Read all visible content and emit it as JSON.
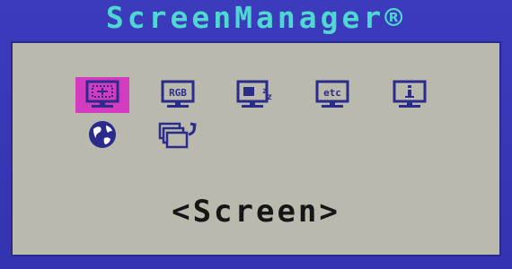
{
  "window": {
    "title": "ScreenManager®"
  },
  "menu": {
    "items": [
      {
        "id": "screen",
        "icon": "screen-icon",
        "selected": true
      },
      {
        "id": "color",
        "icon": "rgb-monitor-icon",
        "selected": false
      },
      {
        "id": "powersave",
        "icon": "sleep-monitor-icon",
        "selected": false
      },
      {
        "id": "others",
        "icon": "etc-monitor-icon",
        "selected": false
      },
      {
        "id": "information",
        "icon": "info-monitor-icon",
        "selected": false
      },
      {
        "id": "language",
        "icon": "globe-icon",
        "selected": false
      },
      {
        "id": "reset",
        "icon": "reset-windows-icon",
        "selected": false
      }
    ],
    "current_label": "<Screen>"
  },
  "colors": {
    "frame": "#3b3bbc",
    "title": "#4fd7d2",
    "panel": "#b9b9ae",
    "selection": "#d43cc0",
    "icon_stroke": "#2b2b8c"
  }
}
